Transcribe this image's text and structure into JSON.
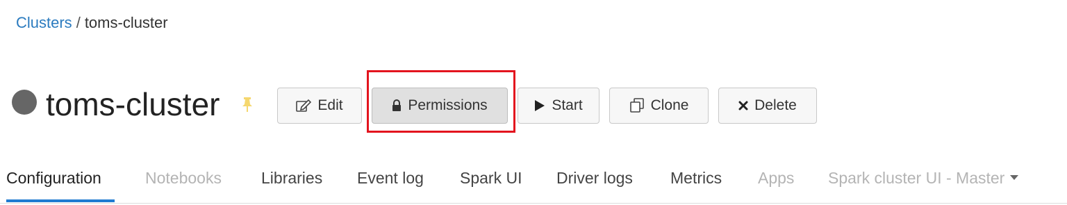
{
  "breadcrumb": {
    "parent": "Clusters",
    "separator": "/",
    "current": "toms-cluster"
  },
  "cluster": {
    "name": "toms-cluster",
    "status_color": "#666666",
    "pin_icon": "pin-icon"
  },
  "actions": {
    "edit": {
      "label": "Edit",
      "icon": "edit-icon"
    },
    "permissions": {
      "label": "Permissions",
      "icon": "lock-icon"
    },
    "start": {
      "label": "Start",
      "icon": "play-icon"
    },
    "clone": {
      "label": "Clone",
      "icon": "copy-icon"
    },
    "delete": {
      "label": "Delete",
      "icon": "close-icon"
    }
  },
  "highlight_color": "#e3141e",
  "tabs": [
    {
      "label": "Configuration",
      "state": "active"
    },
    {
      "label": "Notebooks",
      "state": "muted"
    },
    {
      "label": "Libraries",
      "state": "normal"
    },
    {
      "label": "Event log",
      "state": "normal"
    },
    {
      "label": "Spark UI",
      "state": "normal"
    },
    {
      "label": "Driver logs",
      "state": "normal"
    },
    {
      "label": "Metrics",
      "state": "normal"
    },
    {
      "label": "Apps",
      "state": "muted"
    },
    {
      "label": "Spark cluster UI - Master",
      "state": "muted"
    }
  ],
  "accent_color": "#1f7bd1"
}
